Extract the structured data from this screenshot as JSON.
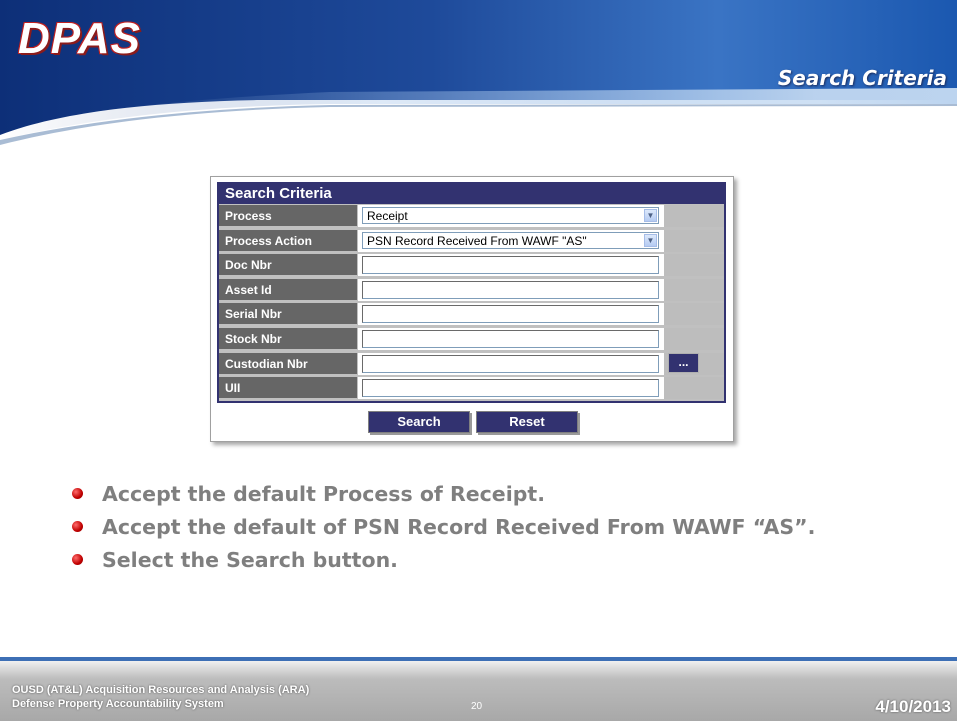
{
  "header": {
    "logo_text": "DPAS",
    "slide_title": "Search Criteria"
  },
  "form": {
    "title": "Search Criteria",
    "fields": [
      {
        "label": "Process",
        "type": "select",
        "value": "Receipt"
      },
      {
        "label": "Process Action",
        "type": "select",
        "value": "PSN Record Received From WAWF \"AS\""
      },
      {
        "label": "Doc Nbr",
        "type": "text",
        "value": ""
      },
      {
        "label": "Asset Id",
        "type": "text",
        "value": ""
      },
      {
        "label": "Serial Nbr",
        "type": "text",
        "value": ""
      },
      {
        "label": "Stock Nbr",
        "type": "text",
        "value": ""
      },
      {
        "label": "Custodian Nbr",
        "type": "text",
        "value": "",
        "lookup_label": "..."
      },
      {
        "label": "UII",
        "type": "text",
        "value": ""
      }
    ],
    "search_label": "Search",
    "reset_label": "Reset"
  },
  "bullets": [
    "Accept the default Process of Receipt.",
    "Accept the default of PSN Record Received From WAWF “AS”.",
    "Select the Search button."
  ],
  "footer": {
    "org_line1": "OUSD (AT&L) Acquisition Resources and Analysis (ARA)",
    "org_line2": "Defense Property Accountability System",
    "page_number": "20",
    "date": "4/10/2013"
  },
  "colors": {
    "navy": "#323270",
    "label_gray": "#666666",
    "bullet_red": "#c00000",
    "header_blue": "#0a2f7a"
  }
}
